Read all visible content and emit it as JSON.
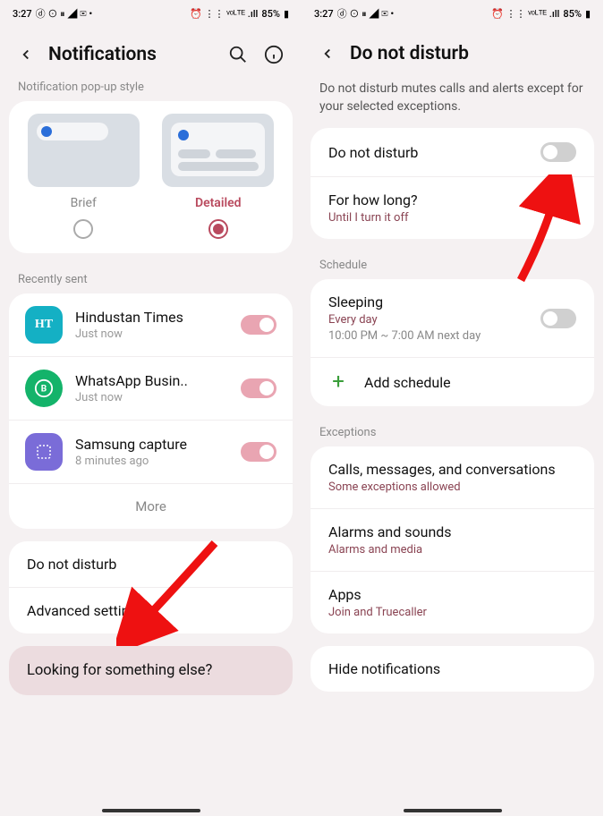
{
  "status": {
    "time": "3:27",
    "battery": "85%"
  },
  "left": {
    "title": "Notifications",
    "popup_label": "Notification pop-up style",
    "brief": "Brief",
    "detailed": "Detailed",
    "recent_label": "Recently sent",
    "apps": [
      {
        "name": "Hindustan Times",
        "sub": "Just now",
        "icon_text": "HT",
        "color": "#14b0c4"
      },
      {
        "name": "WhatsApp Busin..",
        "sub": "Just now",
        "icon_text": "B",
        "color": "#14b36a"
      },
      {
        "name": "Samsung capture",
        "sub": "8 minutes ago",
        "icon_text": "",
        "color": "#7a6cd8"
      }
    ],
    "more": "More",
    "dnd": "Do not disturb",
    "advanced": "Advanced settings",
    "looking": "Looking for something else?"
  },
  "right": {
    "title": "Do not disturb",
    "desc": "Do not disturb mutes calls and alerts except for your selected exceptions.",
    "dnd_label": "Do not disturb",
    "howlong_title": "For how long?",
    "howlong_sub": "Until I turn it off",
    "schedule_label": "Schedule",
    "sleeping_title": "Sleeping",
    "sleeping_sub1": "Every day",
    "sleeping_sub2": "10:00 PM ~ 7:00 AM next day",
    "add_schedule": "Add schedule",
    "exceptions_label": "Exceptions",
    "calls_title": "Calls, messages, and conversations",
    "calls_sub": "Some exceptions allowed",
    "alarms_title": "Alarms and sounds",
    "alarms_sub": "Alarms and media",
    "apps_title": "Apps",
    "apps_sub": "Join and Truecaller",
    "hide": "Hide notifications"
  }
}
